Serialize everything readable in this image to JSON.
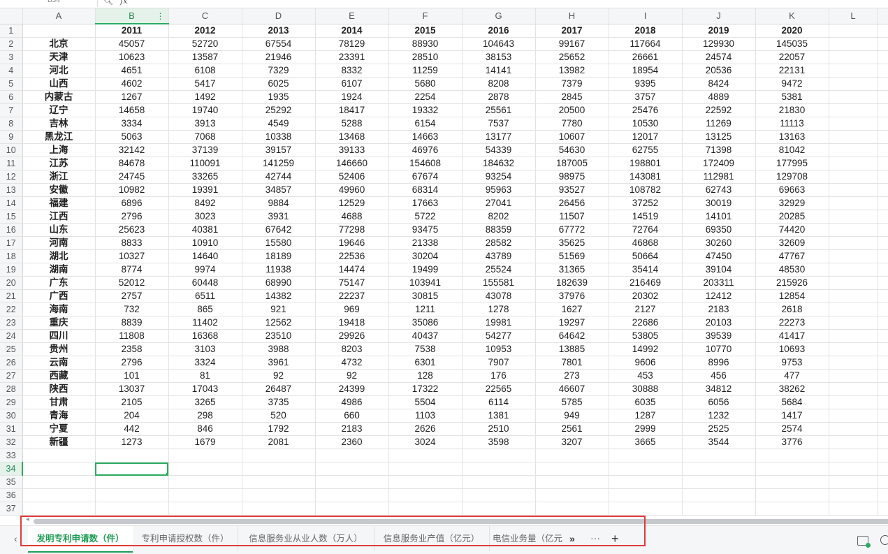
{
  "name_box": "B34",
  "columns": [
    "A",
    "B",
    "C",
    "D",
    "E",
    "F",
    "G",
    "H",
    "I",
    "J",
    "K",
    "L"
  ],
  "rows": [
    {
      "n": "1",
      "c": [
        "",
        "2011",
        "2012",
        "2013",
        "2014",
        "2015",
        "2016",
        "2017",
        "2018",
        "2019",
        "2020",
        ""
      ]
    },
    {
      "n": "2",
      "c": [
        "北京",
        "45057",
        "52720",
        "67554",
        "78129",
        "88930",
        "104643",
        "99167",
        "117664",
        "129930",
        "145035",
        ""
      ]
    },
    {
      "n": "3",
      "c": [
        "天津",
        "10623",
        "13587",
        "21946",
        "23391",
        "28510",
        "38153",
        "25652",
        "26661",
        "24574",
        "22057",
        ""
      ]
    },
    {
      "n": "4",
      "c": [
        "河北",
        "4651",
        "6108",
        "7329",
        "8332",
        "11259",
        "14141",
        "13982",
        "18954",
        "20536",
        "22131",
        ""
      ]
    },
    {
      "n": "5",
      "c": [
        "山西",
        "4602",
        "5417",
        "6025",
        "6107",
        "5680",
        "8208",
        "7379",
        "9395",
        "8424",
        "9472",
        ""
      ]
    },
    {
      "n": "6",
      "c": [
        "内蒙古",
        "1267",
        "1492",
        "1935",
        "1924",
        "2254",
        "2878",
        "2845",
        "3757",
        "4889",
        "5381",
        ""
      ]
    },
    {
      "n": "7",
      "c": [
        "辽宁",
        "14658",
        "19740",
        "25292",
        "18417",
        "19332",
        "25561",
        "20500",
        "25476",
        "22592",
        "21830",
        ""
      ]
    },
    {
      "n": "8",
      "c": [
        "吉林",
        "3334",
        "3913",
        "4549",
        "5288",
        "6154",
        "7537",
        "7780",
        "10530",
        "11269",
        "11113",
        ""
      ]
    },
    {
      "n": "9",
      "c": [
        "黑龙江",
        "5063",
        "7068",
        "10338",
        "13468",
        "14663",
        "13177",
        "10607",
        "12017",
        "13125",
        "13163",
        ""
      ]
    },
    {
      "n": "10",
      "c": [
        "上海",
        "32142",
        "37139",
        "39157",
        "39133",
        "46976",
        "54339",
        "54630",
        "62755",
        "71398",
        "81042",
        ""
      ]
    },
    {
      "n": "11",
      "c": [
        "江苏",
        "84678",
        "110091",
        "141259",
        "146660",
        "154608",
        "184632",
        "187005",
        "198801",
        "172409",
        "177995",
        ""
      ]
    },
    {
      "n": "12",
      "c": [
        "浙江",
        "24745",
        "33265",
        "42744",
        "52406",
        "67674",
        "93254",
        "98975",
        "143081",
        "112981",
        "129708",
        ""
      ]
    },
    {
      "n": "13",
      "c": [
        "安徽",
        "10982",
        "19391",
        "34857",
        "49960",
        "68314",
        "95963",
        "93527",
        "108782",
        "62743",
        "69663",
        ""
      ]
    },
    {
      "n": "14",
      "c": [
        "福建",
        "6896",
        "8492",
        "9884",
        "12529",
        "17663",
        "27041",
        "26456",
        "37252",
        "30019",
        "32929",
        ""
      ]
    },
    {
      "n": "15",
      "c": [
        "江西",
        "2796",
        "3023",
        "3931",
        "4688",
        "5722",
        "8202",
        "11507",
        "14519",
        "14101",
        "20285",
        ""
      ]
    },
    {
      "n": "16",
      "c": [
        "山东",
        "25623",
        "40381",
        "67642",
        "77298",
        "93475",
        "88359",
        "67772",
        "72764",
        "69350",
        "74420",
        ""
      ]
    },
    {
      "n": "17",
      "c": [
        "河南",
        "8833",
        "10910",
        "15580",
        "19646",
        "21338",
        "28582",
        "35625",
        "46868",
        "30260",
        "32609",
        ""
      ]
    },
    {
      "n": "18",
      "c": [
        "湖北",
        "10327",
        "14640",
        "18189",
        "22536",
        "30204",
        "43789",
        "51569",
        "50664",
        "47450",
        "47767",
        ""
      ]
    },
    {
      "n": "19",
      "c": [
        "湖南",
        "8774",
        "9974",
        "11938",
        "14474",
        "19499",
        "25524",
        "31365",
        "35414",
        "39104",
        "48530",
        ""
      ]
    },
    {
      "n": "20",
      "c": [
        "广东",
        "52012",
        "60448",
        "68990",
        "75147",
        "103941",
        "155581",
        "182639",
        "216469",
        "203311",
        "215926",
        ""
      ]
    },
    {
      "n": "21",
      "c": [
        "广西",
        "2757",
        "6511",
        "14382",
        "22237",
        "30815",
        "43078",
        "37976",
        "20302",
        "12412",
        "12854",
        ""
      ]
    },
    {
      "n": "22",
      "c": [
        "海南",
        "732",
        "865",
        "921",
        "969",
        "1211",
        "1278",
        "1627",
        "2127",
        "2183",
        "2618",
        ""
      ]
    },
    {
      "n": "23",
      "c": [
        "重庆",
        "8839",
        "11402",
        "12562",
        "19418",
        "35086",
        "19981",
        "19297",
        "22686",
        "20103",
        "22273",
        ""
      ]
    },
    {
      "n": "24",
      "c": [
        "四川",
        "11808",
        "16368",
        "23510",
        "29926",
        "40437",
        "54277",
        "64642",
        "53805",
        "39539",
        "41417",
        ""
      ]
    },
    {
      "n": "25",
      "c": [
        "贵州",
        "2358",
        "3103",
        "3988",
        "8203",
        "7538",
        "10953",
        "13885",
        "14992",
        "10770",
        "10693",
        ""
      ]
    },
    {
      "n": "26",
      "c": [
        "云南",
        "2796",
        "3324",
        "3961",
        "4732",
        "6301",
        "7907",
        "7801",
        "9606",
        "8996",
        "9753",
        ""
      ]
    },
    {
      "n": "27",
      "c": [
        "西藏",
        "101",
        "81",
        "92",
        "92",
        "128",
        "176",
        "273",
        "453",
        "456",
        "477",
        ""
      ]
    },
    {
      "n": "28",
      "c": [
        "陕西",
        "13037",
        "17043",
        "26487",
        "24399",
        "17322",
        "22565",
        "46607",
        "30888",
        "34812",
        "38262",
        ""
      ]
    },
    {
      "n": "29",
      "c": [
        "甘肃",
        "2105",
        "3265",
        "3735",
        "4986",
        "5504",
        "6114",
        "5785",
        "6035",
        "6056",
        "5684",
        ""
      ]
    },
    {
      "n": "30",
      "c": [
        "青海",
        "204",
        "298",
        "520",
        "660",
        "1103",
        "1381",
        "949",
        "1287",
        "1232",
        "1417",
        ""
      ]
    },
    {
      "n": "31",
      "c": [
        "宁夏",
        "442",
        "846",
        "1792",
        "2183",
        "2626",
        "2510",
        "2561",
        "2999",
        "2525",
        "2574",
        ""
      ]
    },
    {
      "n": "32",
      "c": [
        "新疆",
        "1273",
        "1679",
        "2081",
        "2360",
        "3024",
        "3598",
        "3207",
        "3665",
        "3544",
        "3776",
        ""
      ]
    },
    {
      "n": "33",
      "c": [
        "",
        "",
        "",
        "",
        "",
        "",
        "",
        "",
        "",
        "",
        "",
        ""
      ]
    },
    {
      "n": "34",
      "c": [
        "",
        "",
        "",
        "",
        "",
        "",
        "",
        "",
        "",
        "",
        "",
        ""
      ]
    },
    {
      "n": "35",
      "c": [
        "",
        "",
        "",
        "",
        "",
        "",
        "",
        "",
        "",
        "",
        "",
        ""
      ]
    },
    {
      "n": "36",
      "c": [
        "",
        "",
        "",
        "",
        "",
        "",
        "",
        "",
        "",
        "",
        "",
        ""
      ]
    },
    {
      "n": "37",
      "c": [
        "",
        "",
        "",
        "",
        "",
        "",
        "",
        "",
        "",
        "",
        "",
        ""
      ]
    }
  ],
  "sheet_tabs": [
    {
      "label": "发明专利申请数（件）",
      "active": true
    },
    {
      "label": "专利申请授权数（件）",
      "active": false
    },
    {
      "label": "信息服务业从业人数（万人）",
      "active": false
    },
    {
      "label": "信息服务业产值（亿元）",
      "active": false
    },
    {
      "label": "电信业务量（亿元",
      "active": false
    }
  ],
  "tab_controls": {
    "nav_left": "‹",
    "more": "»",
    "ellipsis": "···",
    "add": "+"
  },
  "colors": {
    "accent": "#1f9d55",
    "highlight_box": "#e03c3c"
  }
}
